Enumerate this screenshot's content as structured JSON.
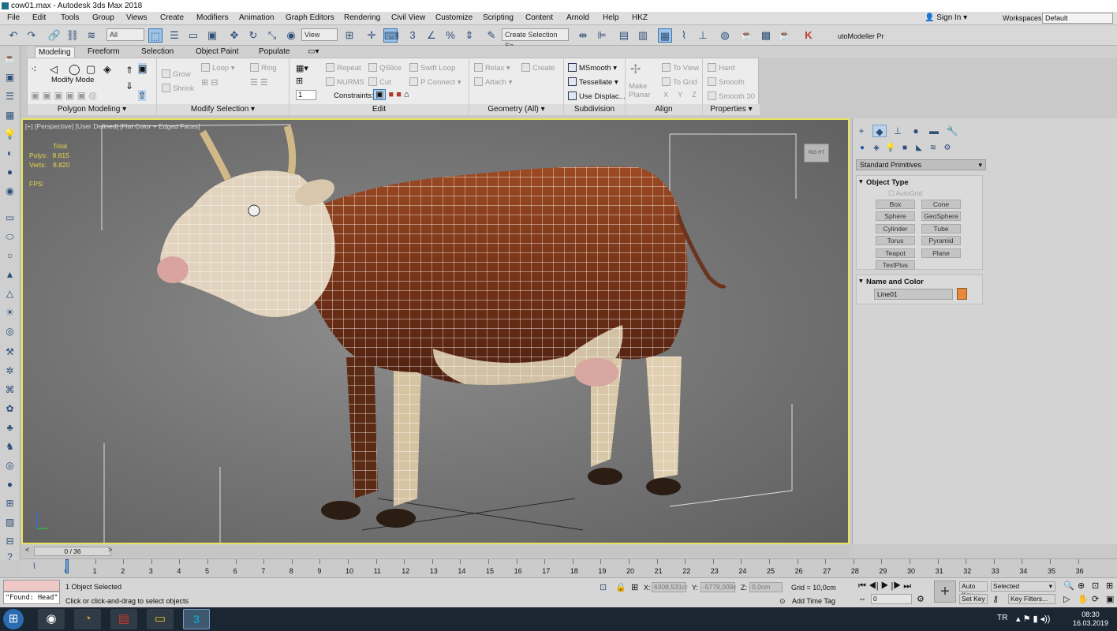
{
  "window": {
    "title": "cow01.max - Autodesk 3ds Max 2018"
  },
  "menubar": {
    "items": [
      "File",
      "Edit",
      "Tools",
      "Group",
      "Views",
      "Create",
      "Modifiers",
      "Animation",
      "Graph Editors",
      "Rendering",
      "Civil View",
      "Customize",
      "Scripting",
      "Content",
      "Arnold",
      "Help",
      "HKZ"
    ],
    "sign_in": "Sign In",
    "workspaces_label": "Workspaces:",
    "workspace_value": "Default"
  },
  "toolbar": {
    "selection_filter": "All",
    "ref_coord": "View",
    "named_selection": "Create Selection Se",
    "plugin_label": "utoModeller Pr"
  },
  "ribbon": {
    "tabs": [
      "Modeling",
      "Freeform",
      "Selection",
      "Object Paint",
      "Populate"
    ],
    "polygon_modeling": {
      "mode": "Modify Mode",
      "footer": "Polygon Modeling"
    },
    "modify_selection": {
      "grow": "Grow",
      "shrink": "Shrink",
      "loop": "Loop",
      "ring": "Ring",
      "footer": "Modify Selection"
    },
    "edit": {
      "repeat": "Repeat",
      "qslice": "QSlice",
      "swift_loop": "Swift Loop",
      "nurms": "NURMS",
      "cut": "Cut",
      "p_connect": "P Connect",
      "spinner_value": "1",
      "constraints": "Constraints:",
      "footer": "Edit"
    },
    "geometry": {
      "relax": "Relax",
      "create": "Create",
      "attach": "Attach",
      "footer": "Geometry (All)"
    },
    "subdivision": {
      "msmooth": "MSmooth",
      "tessellate": "Tessellate",
      "use_displac": "Use Displac...",
      "footer": "Subdivision"
    },
    "align": {
      "make_planar": "Make Planar",
      "to_view": "To View",
      "to_grid": "To Grid",
      "x": "X",
      "y": "Y",
      "z": "Z",
      "footer": "Align"
    },
    "properties": {
      "hard": "Hard",
      "smooth": "Smooth",
      "smooth30": "Smooth 30",
      "footer": "Properties"
    }
  },
  "viewport": {
    "label": "[+] [Perspective] [User Defined] [Flat Color + Edged Faces]",
    "stats": {
      "total": "Total",
      "polys_label": "Polys:",
      "polys": "8.815",
      "verts_label": "Verts:",
      "verts": "8.820",
      "fps_label": "FPS:"
    },
    "viewcube_label": "RIG HT"
  },
  "command_panel": {
    "category": "Standard Primitives",
    "object_type_title": "Object Type",
    "autogrid": "AutoGrid",
    "primitives": [
      "Box",
      "Cone",
      "Sphere",
      "GeoSphere",
      "Cylinder",
      "Tube",
      "Torus",
      "Pyramid",
      "Teapot",
      "Plane",
      "TextPlus"
    ],
    "name_color_title": "Name and Color",
    "object_name": "Line01",
    "object_color": "#e8883a"
  },
  "timeline": {
    "slider_label": "0 / 36",
    "ticks": [
      "0",
      "1",
      "2",
      "3",
      "4",
      "5",
      "6",
      "7",
      "8",
      "9",
      "10",
      "11",
      "12",
      "13",
      "14",
      "15",
      "16",
      "17",
      "18",
      "19",
      "20",
      "21",
      "22",
      "23",
      "24",
      "25",
      "26",
      "27",
      "28",
      "29",
      "30",
      "31",
      "32",
      "33",
      "34",
      "35",
      "36"
    ]
  },
  "status": {
    "maxscript_output": "\"Found: Head\"",
    "selection_status": "1 Object Selected",
    "prompt": "Click or click-and-drag to select objects",
    "x_label": "X:",
    "x_value": "6308,531cr",
    "y_label": "Y:",
    "y_value": "-5779,009c",
    "z_label": "Z:",
    "z_value": "0,0cm",
    "grid": "Grid = 10,0cm",
    "add_time_tag": "Add Time Tag",
    "auto_key": "Auto Key",
    "set_key": "Set Key",
    "key_mode": "Selected",
    "key_filters": "Key Filters...",
    "frame": "0"
  },
  "taskbar": {
    "lang": "TR",
    "time": "08:30",
    "date": "16.03.2019"
  }
}
